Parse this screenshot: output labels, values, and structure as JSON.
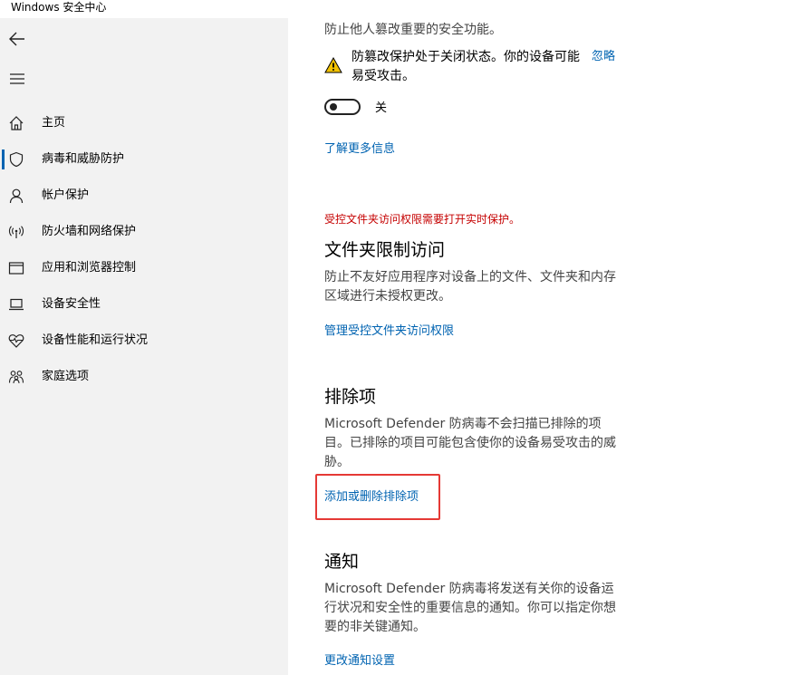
{
  "window": {
    "title": "Windows 安全中心"
  },
  "sidebar": {
    "items": [
      {
        "label": "主页",
        "icon": "home-icon"
      },
      {
        "label": "病毒和威胁防护",
        "icon": "shield-icon",
        "active": true
      },
      {
        "label": "帐户保护",
        "icon": "person-icon"
      },
      {
        "label": "防火墙和网络保护",
        "icon": "antenna-icon"
      },
      {
        "label": "应用和浏览器控制",
        "icon": "browser-window-icon"
      },
      {
        "label": "设备安全性",
        "icon": "laptop-icon"
      },
      {
        "label": "设备性能和运行状况",
        "icon": "heart-pulse-icon"
      },
      {
        "label": "家庭选项",
        "icon": "family-icon"
      }
    ]
  },
  "tamper": {
    "description": "防止他人篡改重要的安全功能。",
    "warning": "防篡改保护处于关闭状态。你的设备可能易受攻击。",
    "dismiss_link": "忽略",
    "toggle_label": "关",
    "toggle_on": false,
    "learn_more_link": "了解更多信息"
  },
  "folder_access": {
    "notice": "受控文件夹访问权限需要打开实时保护。",
    "title": "文件夹限制访问",
    "description": "防止不友好应用程序对设备上的文件、文件夹和内存区域进行未授权更改。",
    "link": "管理受控文件夹访问权限"
  },
  "exclusions": {
    "title": "排除项",
    "description": "Microsoft Defender 防病毒不会扫描已排除的项目。已排除的项目可能包含使你的设备易受攻击的威胁。",
    "link": "添加或删除排除项"
  },
  "notifications": {
    "title": "通知",
    "description": "Microsoft Defender 防病毒将发送有关你的设备运行状况和安全性的重要信息的通知。你可以指定你想要的非关键通知。",
    "link": "更改通知设置"
  },
  "colors": {
    "accent": "#0063b1",
    "warning_red": "#c50000",
    "highlight": "#e53935",
    "sidebar_bg": "#f2f2f2"
  }
}
